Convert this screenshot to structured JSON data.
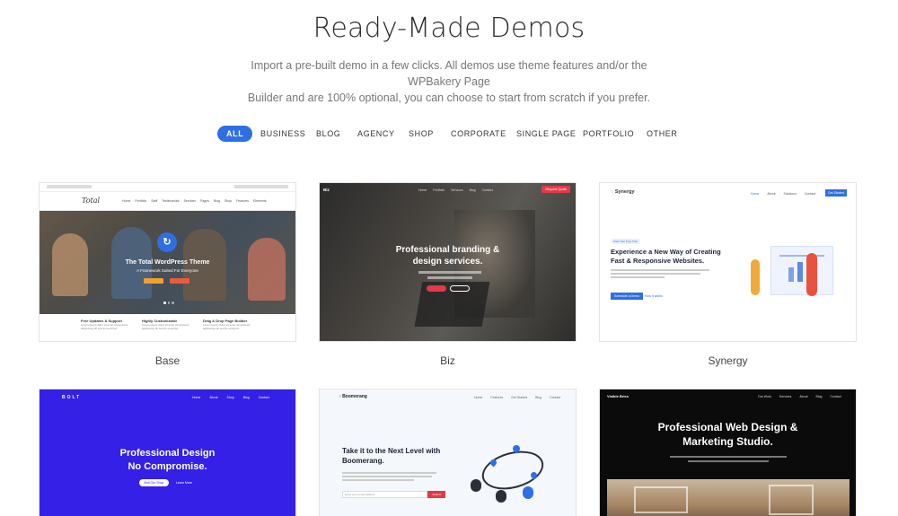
{
  "header": {
    "title": "Ready-Made Demos",
    "subtitle_line1": "Import a pre-built demo in a few clicks.  All demos use theme features and/or the WPBakery Page",
    "subtitle_line2": "Builder and are 100% optional, you can choose to start from scratch if you prefer."
  },
  "filters": [
    "ALL",
    "BUSINESS",
    "BLOG",
    "AGENCY",
    "SHOP",
    "CORPORATE",
    "SINGLE PAGE",
    "PORTFOLIO",
    "OTHER"
  ],
  "colors": {
    "accent": "#2f6fe4",
    "bolt_bg": "#3420e6"
  },
  "demos": {
    "base": {
      "name": "Base",
      "logo": "Total",
      "nav": [
        "Home",
        "Portfolio",
        "Staff",
        "Testimonials",
        "Services",
        "Pages",
        "Blog",
        "Shop",
        "Features",
        "Elements"
      ],
      "hero_title": "The Total WordPress Theme",
      "hero_subtitle": "A Framework Suited For Everyone",
      "features": [
        {
          "title": "Free Updates & Support",
          "text": "Lorem ipsum dolor sit amet consectetur adipiscing elit sed do eiusmod."
        },
        {
          "title": "Highly Customizable",
          "text": "Lorem ipsum dolor sit amet consectetur adipiscing elit sed do eiusmod."
        },
        {
          "title": "Drag & Drop Page Builder",
          "text": "Lorem ipsum dolor sit amet consectetur adipiscing elit sed do eiusmod."
        }
      ]
    },
    "biz": {
      "name": "Biz",
      "logo": "Biz",
      "nav": [
        "Home",
        "Portfolio",
        "Services",
        "Blog",
        "Contact"
      ],
      "cta": "Request Quote",
      "hero_line1": "Professional branding &",
      "hero_line2": "design services."
    },
    "synergy": {
      "name": "Synergy",
      "logo": "Synergy",
      "nav": [
        "Home",
        "About",
        "Solutions",
        "Contact"
      ],
      "cta": "Get Started",
      "tag": "Start Your Free Trial",
      "hero_line1": "Experience a New Way of Creating",
      "hero_line2": "Fast & Responsive Websites.",
      "button": "Schedule a Demo",
      "link": "How it works"
    },
    "bolt": {
      "logo": "BOLT",
      "nav": [
        "Home",
        "About",
        "Shop",
        "Blog",
        "Contact"
      ],
      "hero_line1": "Professional Design",
      "hero_line2": "No Compromise.",
      "btn1": "Visit Our Shop",
      "btn2": "Learn More"
    },
    "boomerang": {
      "logo": "Boomerang",
      "nav": [
        "Home",
        "Features",
        "Get Started",
        "Blog",
        "Contact"
      ],
      "hero_line1": "Take it to the Next Level with",
      "hero_line2": "Boomerang.",
      "input_placeholder": "Enter your email address",
      "submit": "Submit"
    },
    "web": {
      "logo": "Visible Brics",
      "nav": [
        "Our Work",
        "Services",
        "About",
        "Blog",
        "Contact"
      ],
      "hero_line1": "Professional Web Design &",
      "hero_line2": "Marketing Studio."
    }
  }
}
